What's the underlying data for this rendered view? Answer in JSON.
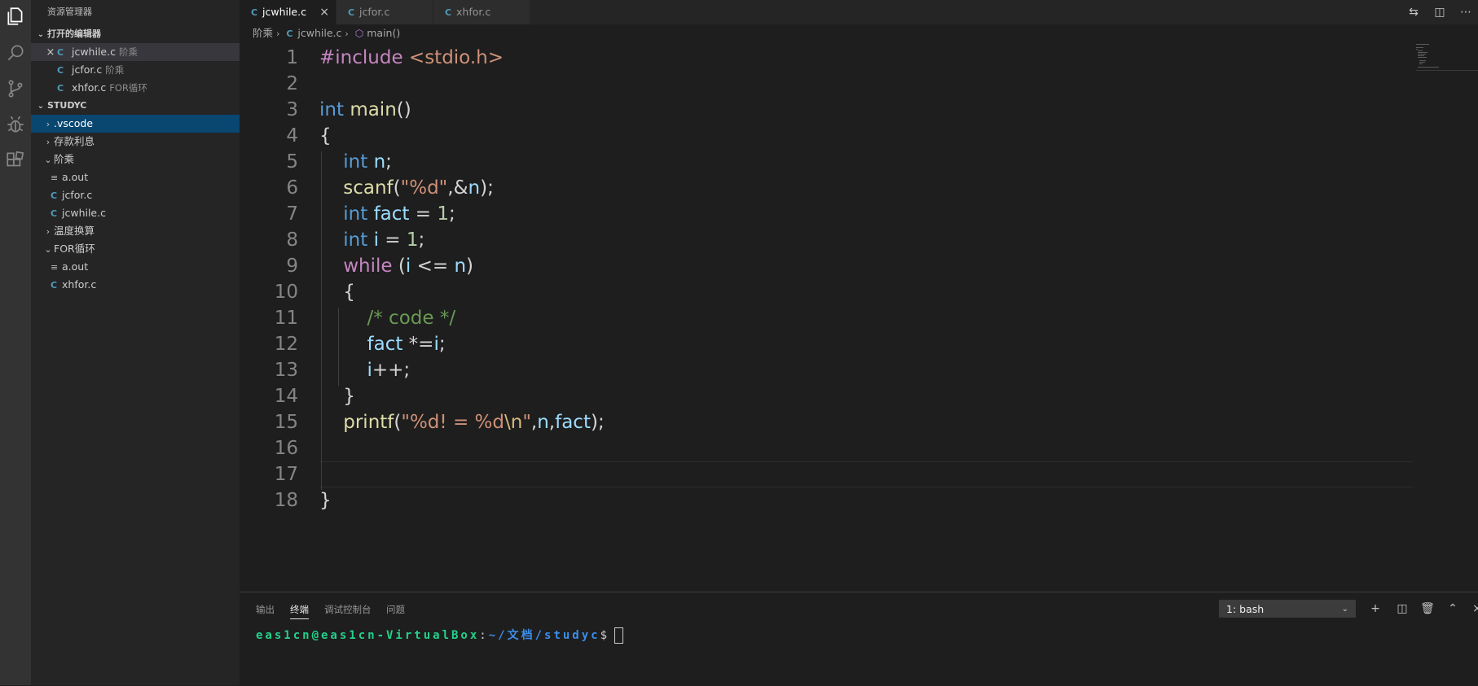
{
  "sidebar": {
    "title": "资源管理器",
    "open_editors_header": "打开的编辑器",
    "open_editors": [
      {
        "name": "jcwhile.c",
        "desc": "阶乘"
      },
      {
        "name": "jcfor.c",
        "desc": "阶乘"
      },
      {
        "name": "xhfor.c",
        "desc": "FOR循环"
      }
    ],
    "workspace_header": "STUDYC",
    "tree": {
      "vscode": ".vscode",
      "cunkuan": "存款利息",
      "jiecheng": "阶乘",
      "jc_aout": "a.out",
      "jc_jcfor": "jcfor.c",
      "jc_jcwhile": "jcwhile.c",
      "wendu": "温度换算",
      "forxh": "FOR循环",
      "for_aout": "a.out",
      "for_xhfor": "xhfor.c"
    }
  },
  "tabs": [
    {
      "label": "jcwhile.c"
    },
    {
      "label": "jcfor.c"
    },
    {
      "label": "xhfor.c"
    }
  ],
  "breadcrumb": {
    "folder": "阶乘",
    "file": "jcwhile.c",
    "symbol": "main()"
  },
  "editor": {
    "line_numbers": [
      "1",
      "2",
      "3",
      "4",
      "5",
      "6",
      "7",
      "8",
      "9",
      "10",
      "11",
      "12",
      "13",
      "14",
      "15",
      "16",
      "17",
      "18"
    ]
  },
  "panel": {
    "tabs": [
      "输出",
      "终端",
      "调试控制台",
      "问题"
    ],
    "terminal_select": "1: bash",
    "prompt_user": "eas1cn@eas1cn-VirtualBox",
    "prompt_sep": ":",
    "prompt_path": "~/文档/studyc",
    "prompt_end": "$"
  },
  "colors": {
    "activity_bar": "#333333",
    "sidebar_bg": "#252526",
    "editor_bg": "#1e1e1e",
    "selection": "#094771",
    "c_icon": "#519aba"
  }
}
